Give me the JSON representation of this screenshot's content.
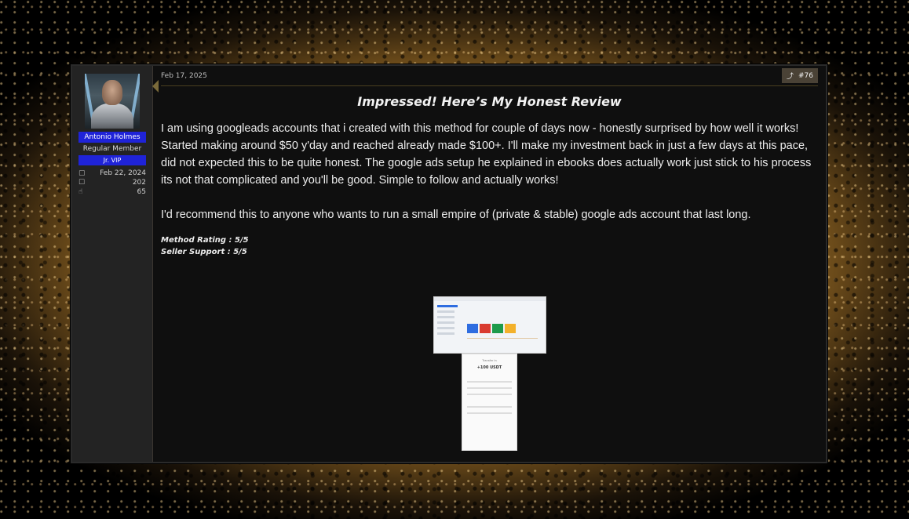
{
  "user": {
    "name": "Antonio Holmes",
    "role": "Regular Member",
    "banner": "Jr. VIP",
    "stats": [
      {
        "icon": "calendar-icon",
        "glyph": "▢",
        "value": "Feb 22, 2024"
      },
      {
        "icon": "messages-icon",
        "glyph": "☐",
        "value": "202"
      },
      {
        "icon": "thumbs-up-icon",
        "glyph": "☝",
        "value": "65"
      }
    ]
  },
  "post": {
    "date": "Feb 17, 2025",
    "number": "#76",
    "share_glyph": "⤴",
    "title": "Impressed! Here’s My Honest Review",
    "paragraphs": [
      "I am using googleads accounts that i created with this method for couple of days now - honestly surprised by how well it works! Started making around $50 y'day and reached already made $100+. I'll make my investment back in just a few days at this pace, did not expected this to be quite honest. The google ads setup he explained in ebooks does actually work just stick to his process its not that complicated and you'll be good. Simple to follow and actually works!",
      "I'd recommend this to anyone who wants to run a small empire of (private & stable) google ads account that last long."
    ],
    "ratings": [
      "Method Rating : 5/5",
      "Seller Support : 5/5"
    ],
    "screenshot2": {
      "heading": "Transfer in",
      "amount": "+100 USDT"
    }
  },
  "colors": {
    "accent_blue": "#1f23d8",
    "gold": "#b8893a"
  }
}
